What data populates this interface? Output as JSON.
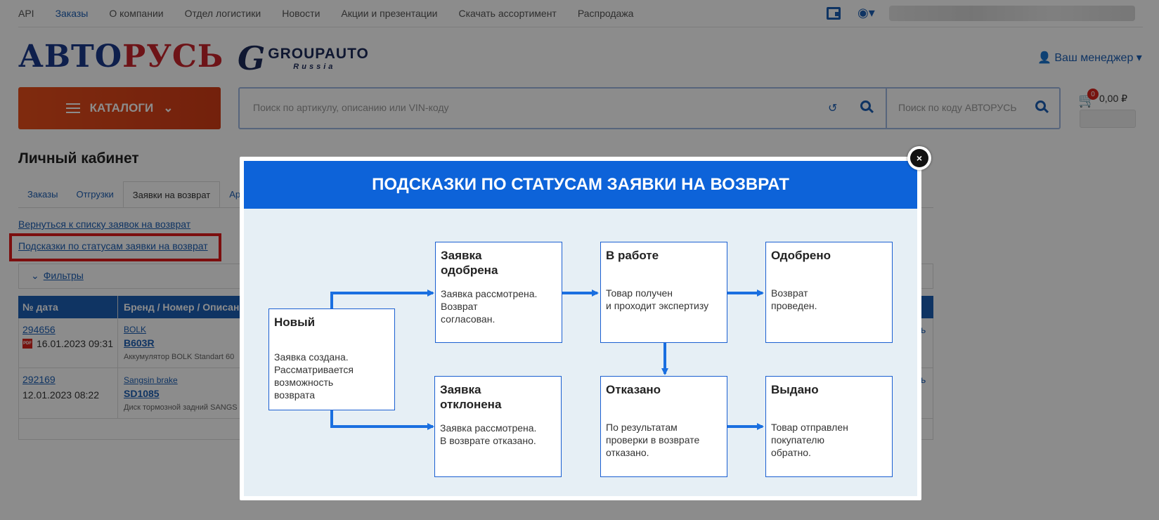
{
  "topnav": {
    "items": [
      "API",
      "Заказы",
      "О компании",
      "Отдел логистики",
      "Новости",
      "Акции и презентации",
      "Скачать ассортимент",
      "Распродажа"
    ],
    "active_index": 1
  },
  "logo": {
    "part1": "АВТО",
    "part2": "РУСЬ",
    "ga_letter": "G",
    "ga_name": "GROUPAUTO",
    "ga_region": "Russia"
  },
  "header": {
    "manager": "Ваш менеджер"
  },
  "catalog": {
    "label": "КАТАЛОГИ"
  },
  "search": {
    "main_placeholder": "Поиск по артикулу, описанию или VIN-коду",
    "code_placeholder": "Поиск по коду АВТОРУСЬ"
  },
  "cart": {
    "count": "0",
    "sum": "0,00 ₽"
  },
  "cabinet": {
    "title": "Личный кабинет",
    "tabs": [
      "Заказы",
      "Отгрузки",
      "Заявки на возврат",
      "Ар"
    ],
    "active_tab": 2,
    "back_link": "Вернуться к списку заявок на возврат",
    "hints_link": "Подсказки по статусам заявки на возврат",
    "filters": "Фильтры"
  },
  "table": {
    "headers": [
      "№ дата",
      "Бренд / Номер / Описан"
    ],
    "rows": [
      {
        "num": "294656",
        "date": "16.01.2023 09:31",
        "brand": "BOLK",
        "part": "B603R",
        "desc": "Аккумулятор BOLK Standart 60",
        "tail": "ь"
      },
      {
        "num": "292169",
        "date": "12.01.2023 08:22",
        "brand": "Sangsin brake",
        "part": "SD1085",
        "desc": "Диск тормозной задний SANGS",
        "tail": "ь"
      }
    ]
  },
  "modal": {
    "title": "ПОДСКАЗКИ ПО СТАТУСАМ ЗАЯВКИ НА ВОЗВРАТ",
    "close_label": "×",
    "statuses": {
      "new": {
        "title": "Новый",
        "desc": "Заявка создана.\nРассматривается\nвозможность\nвозврата"
      },
      "approved_req": {
        "title": "Заявка\nодобрена",
        "desc": "Заявка рассмотрена.\nВозврат\nсогласован."
      },
      "in_work": {
        "title": "В работе",
        "desc": "Товар получен\nи проходит экспертизу"
      },
      "approved": {
        "title": "Одобрено",
        "desc": "Возврат\nпроведен."
      },
      "rejected_req": {
        "title": "Заявка\nотклонена",
        "desc": "Заявка рассмотрена.\nВ возврате отказано."
      },
      "denied": {
        "title": "Отказано",
        "desc": "По результатам\nпроверки в возврате\nотказано."
      },
      "issued": {
        "title": "Выдано",
        "desc": "Товар отправлен\nпокупателю\nобратно."
      }
    }
  },
  "colors": {
    "brand_blue": "#1d5fb4",
    "modal_header": "#0d63d9",
    "catalog_orange": "#e84e1b",
    "highlight_red": "#e21b1b"
  }
}
